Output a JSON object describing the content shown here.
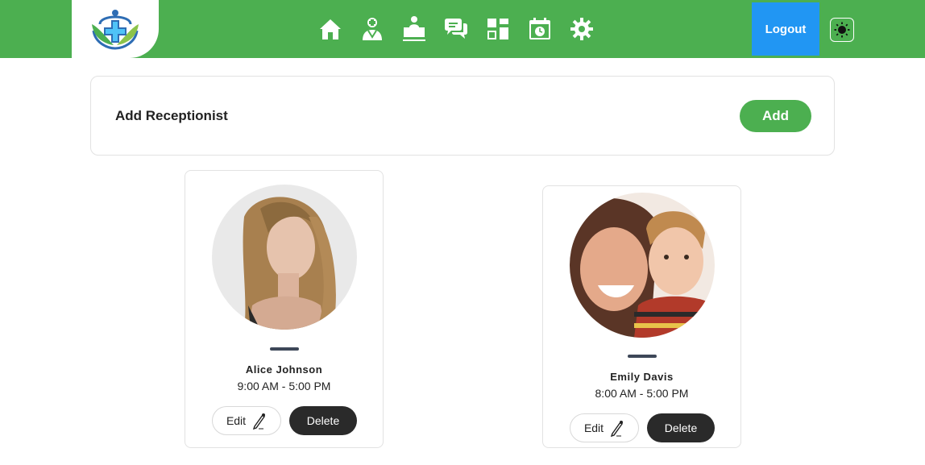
{
  "header": {
    "logo_icon": "medical-cross-logo",
    "nav_icons": [
      "home-icon",
      "doctor-icon",
      "reception-desk-icon",
      "chat-icon",
      "dashboard-icon",
      "calendar-icon",
      "settings-icon"
    ],
    "logout_label": "Logout",
    "theme_icon": "sun-icon",
    "colors": {
      "nav_bg": "#4caf50",
      "logout_bg": "#2196f3"
    }
  },
  "add_panel": {
    "title": "Add Receptionist",
    "button_label": "Add"
  },
  "receptionists": [
    {
      "name": "Alice Johnson",
      "hours": "9:00 AM - 5:00 PM",
      "edit_label": "Edit",
      "delete_label": "Delete"
    },
    {
      "name": "Emily Davis",
      "hours": "8:00 AM - 5:00 PM",
      "edit_label": "Edit",
      "delete_label": "Delete"
    }
  ]
}
